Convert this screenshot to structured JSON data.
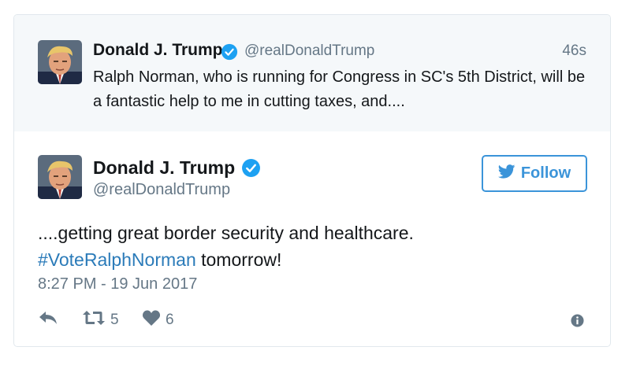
{
  "parent_tweet": {
    "author_name": "Donald J. Trump",
    "handle": "@realDonaldTrump",
    "timestamp": "46s",
    "text": "Ralph Norman, who is running for Congress in SC's 5th District, will be a fantastic help to me in cutting taxes, and...."
  },
  "main_tweet": {
    "author_name": "Donald J. Trump",
    "handle": "@realDonaldTrump",
    "follow_label": "Follow",
    "text_line1": "....getting great border security and healthcare.",
    "hashtag": "#VoteRalphNorman",
    "text_after_hashtag": " tomorrow!",
    "timestamp": "8:27 PM - 19 Jun 2017",
    "retweet_count": "5",
    "like_count": "6"
  },
  "colors": {
    "accent_blue": "#3b94d9",
    "hashtag_blue": "#2b7bb9",
    "secondary_text": "#657786",
    "parent_background": "#f5f8fa",
    "verified_badge": "#1da1f2"
  },
  "icons": {
    "verified": "verified-badge-icon",
    "follow": "twitter-bird-icon",
    "reply": "reply-icon",
    "retweet": "retweet-icon",
    "like": "heart-icon",
    "info": "info-icon"
  }
}
